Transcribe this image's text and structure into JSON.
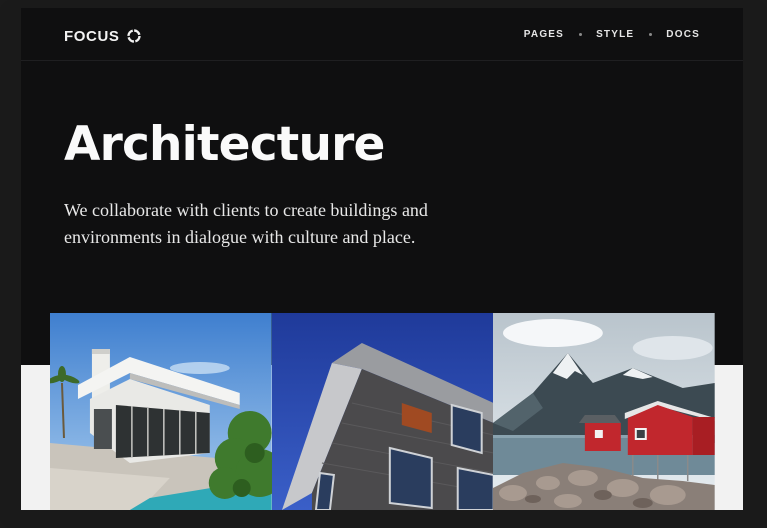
{
  "brand": {
    "name": "FOCUS",
    "icon": "focus-ring-icon"
  },
  "nav": {
    "items": [
      {
        "label": "PAGES"
      },
      {
        "label": "STYLE"
      },
      {
        "label": "DOCS"
      }
    ]
  },
  "hero": {
    "title": "Architecture",
    "subtitle": "We collaborate with clients to create buildings and environments in dialogue with culture and place."
  },
  "gallery": {
    "items": [
      {
        "name": "modern-villa-photo"
      },
      {
        "name": "brick-building-photo"
      },
      {
        "name": "red-cabin-photo"
      }
    ]
  },
  "colors": {
    "background": "#0f0f10",
    "frame": "#1a1a1a",
    "band": "#f2f2f2",
    "text": "#fafafa"
  }
}
